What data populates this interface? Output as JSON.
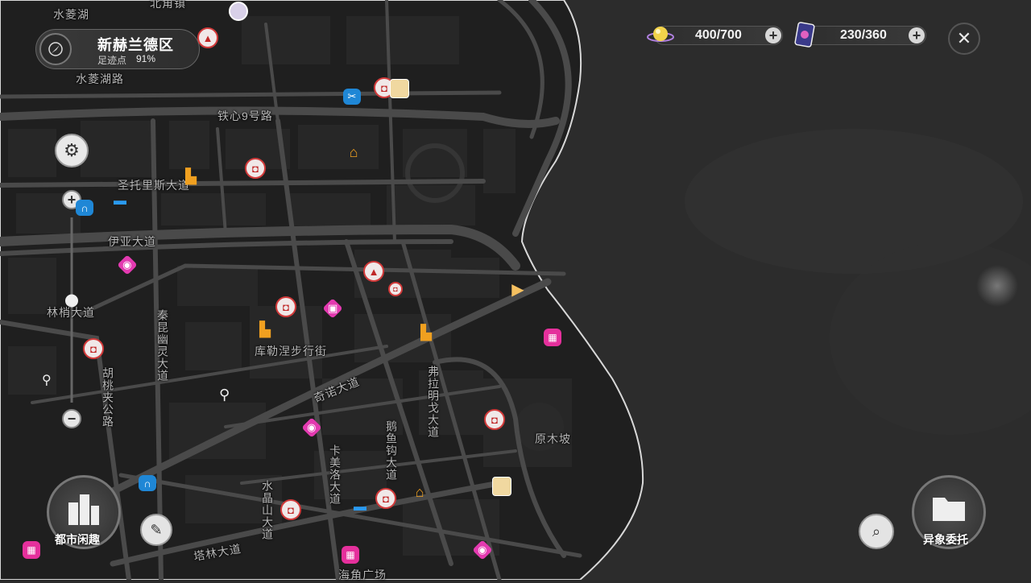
{
  "region": {
    "name": "新赫兰德区",
    "progress_label": "足迹点",
    "progress_value": "91%"
  },
  "resources": [
    {
      "icon": "stamina-orb-icon",
      "value": "400/700"
    },
    {
      "icon": "card-pack-icon",
      "value": "230/360"
    }
  ],
  "zoom_level": 0.45,
  "road_labels": {
    "shuiling_lake": "水菱湖",
    "north_town": "北角镇",
    "shuiling_road": "水菱湖路",
    "tiexin_road": "铁心9号路",
    "santoris_ave": "圣托里斯大道",
    "yia_ave": "伊亚大道",
    "lin_ave": "林梢大道",
    "kuleni_street": "库勒涅步行街",
    "qinuo_ave": "奇诺大道",
    "huli_road": "胡桃夹公路",
    "sechang_ave": "秦昆幽灵大道",
    "fulami_ave": "弗拉明戈大道",
    "kamei_ave": "卡美洛大道",
    "luyu_ave": "鹅鱼钩大道",
    "shuijing_ave": "水晶山大道",
    "talin_ave": "塔林大道",
    "haijiao_plaza": "海角广场",
    "yuanmu_slope": "原木坡"
  },
  "buttons": {
    "city_fun": "都市闲趣",
    "anomaly_commission": "异象委托"
  },
  "colors": {
    "ocean": "#2b2b2b",
    "land": "#232323",
    "road": "#4a4a4a",
    "coast": "#d0d0d0",
    "accent_red": "#d23a3a",
    "accent_pink": "#e33ab0",
    "accent_blue": "#1f87d6",
    "accent_yellow": "#f0a020"
  }
}
